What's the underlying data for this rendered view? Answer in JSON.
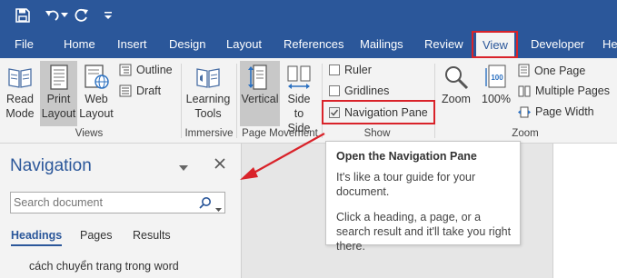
{
  "quick_access": {
    "icons": [
      "save-icon",
      "undo-icon",
      "redo-icon",
      "customize-icon"
    ]
  },
  "tabs": [
    "File",
    "Home",
    "Insert",
    "Design",
    "Layout",
    "References",
    "Mailings",
    "Review",
    "View",
    "Developer",
    "He"
  ],
  "active_tab": "View",
  "ribbon": {
    "views": {
      "read_mode": "Read\nMode",
      "print_layout": "Print\nLayout",
      "web_layout": "Web\nLayout",
      "outline": "Outline",
      "draft": "Draft",
      "group_label": "Views"
    },
    "immersive": {
      "learning_tools": "Learning\nTools",
      "group_label": "Immersive"
    },
    "page_movement": {
      "vertical": "Vertical",
      "side_to_side": "Side\nto Side",
      "group_label": "Page Movement"
    },
    "show": {
      "ruler": "Ruler",
      "ruler_checked": false,
      "gridlines": "Gridlines",
      "gridlines_checked": false,
      "navigation_pane": "Navigation Pane",
      "navigation_pane_checked": true,
      "group_label": "Show"
    },
    "zoom": {
      "zoom": "Zoom",
      "hundred": "100%",
      "one_page": "One Page",
      "multiple_pages": "Multiple Pages",
      "page_width": "Page Width",
      "group_label": "Zoom"
    }
  },
  "navigation": {
    "title": "Navigation",
    "search_placeholder": "Search document",
    "tabs": [
      "Headings",
      "Pages",
      "Results"
    ],
    "active_tab": "Headings",
    "heading_item": "cách chuyển trang trong word"
  },
  "tooltip": {
    "title": "Open the Navigation Pane",
    "line1": "It's like a tour guide for your document.",
    "line2": "Click a heading, a page, or a search result and it'll take you right there."
  },
  "colors": {
    "brand": "#2b579a",
    "highlight": "#d9232a",
    "ribbon_bg": "#f3f3f3"
  }
}
